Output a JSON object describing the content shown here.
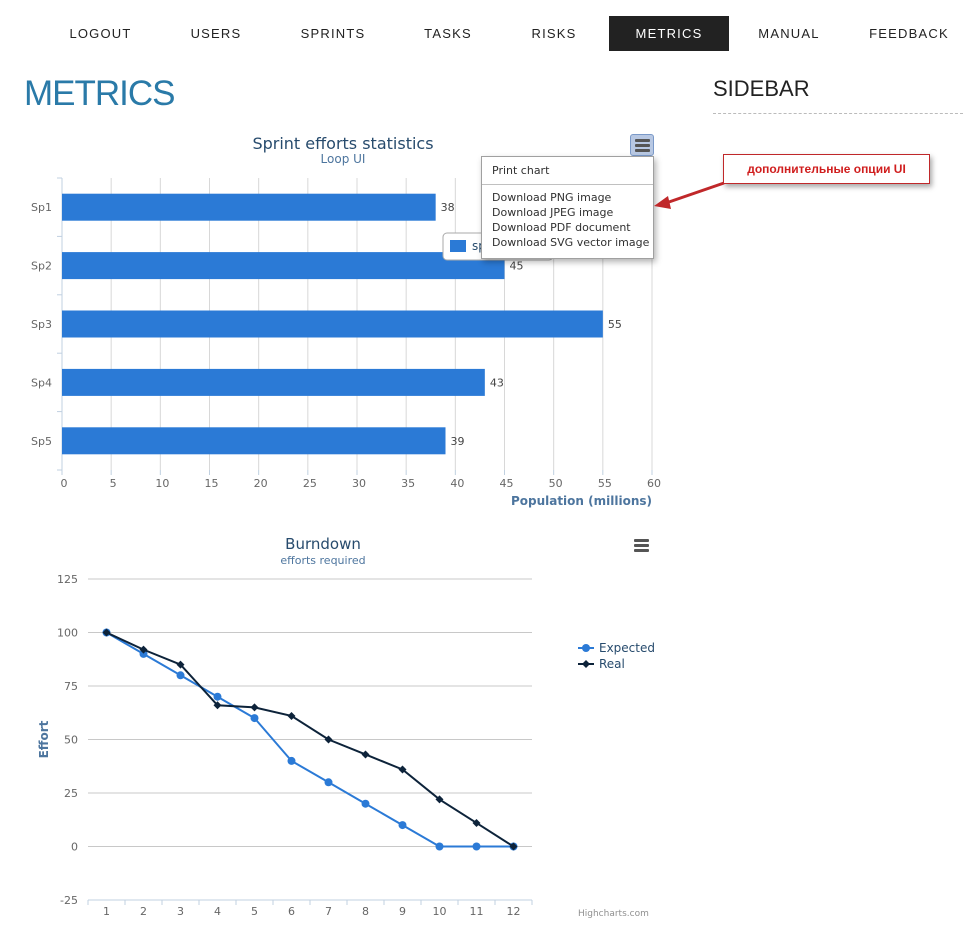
{
  "nav": [
    {
      "label": "LOGOUT",
      "active": false
    },
    {
      "label": "USERS",
      "active": false
    },
    {
      "label": "SPRINTS",
      "active": false
    },
    {
      "label": "TASKS",
      "active": false
    },
    {
      "label": "RISKS",
      "active": false
    },
    {
      "label": "METRICS",
      "active": true
    },
    {
      "label": "MANUAL",
      "active": false
    },
    {
      "label": "FEEDBACK",
      "active": false
    }
  ],
  "page_title": "METRICS",
  "sidebar": {
    "title": "SIDEBAR"
  },
  "export_menu": {
    "print": "Print chart",
    "png": "Download PNG image",
    "jpeg": "Download JPEG image",
    "pdf": "Download PDF document",
    "svg": "Download SVG vector image"
  },
  "annotation": {
    "text": "дополнительные опции UI",
    "color": "#d01e1e"
  },
  "credits": "Highcharts.com",
  "chart_data": [
    {
      "type": "bar",
      "orientation": "horizontal",
      "title": "Sprint efforts statistics",
      "subtitle": "Loop UI",
      "categories": [
        "Sp1",
        "Sp2",
        "Sp3",
        "Sp4",
        "Sp5"
      ],
      "values": [
        38,
        45,
        55,
        43,
        39
      ],
      "xlabel": "Population (millions)",
      "ylabel": "",
      "xlim": [
        0,
        60
      ],
      "ticks": [
        0,
        5,
        10,
        15,
        20,
        25,
        30,
        35,
        40,
        45,
        50,
        55,
        60
      ],
      "legend_visible_text": "sp",
      "grid": true,
      "data_labels": true,
      "color": "#2b7ad6"
    },
    {
      "type": "line",
      "title": "Burndown",
      "subtitle": "efforts required",
      "x": [
        1,
        2,
        3,
        4,
        5,
        6,
        7,
        8,
        9,
        10,
        11,
        12
      ],
      "series": [
        {
          "name": "Expected",
          "values": [
            100,
            90,
            80,
            70,
            60,
            40,
            30,
            20,
            10,
            0,
            0,
            0
          ],
          "color": "#2b7ad6",
          "marker": "circle"
        },
        {
          "name": "Real",
          "values": [
            100,
            92,
            85,
            66,
            65,
            61,
            50,
            43,
            36,
            22,
            11,
            0
          ],
          "color": "#0d233a",
          "marker": "diamond"
        }
      ],
      "xlabel": "",
      "ylabel": "Effort",
      "ylim": [
        -25,
        125
      ],
      "yticks": [
        -25,
        0,
        25,
        50,
        75,
        100,
        125
      ],
      "legend": "right",
      "grid": true
    }
  ]
}
